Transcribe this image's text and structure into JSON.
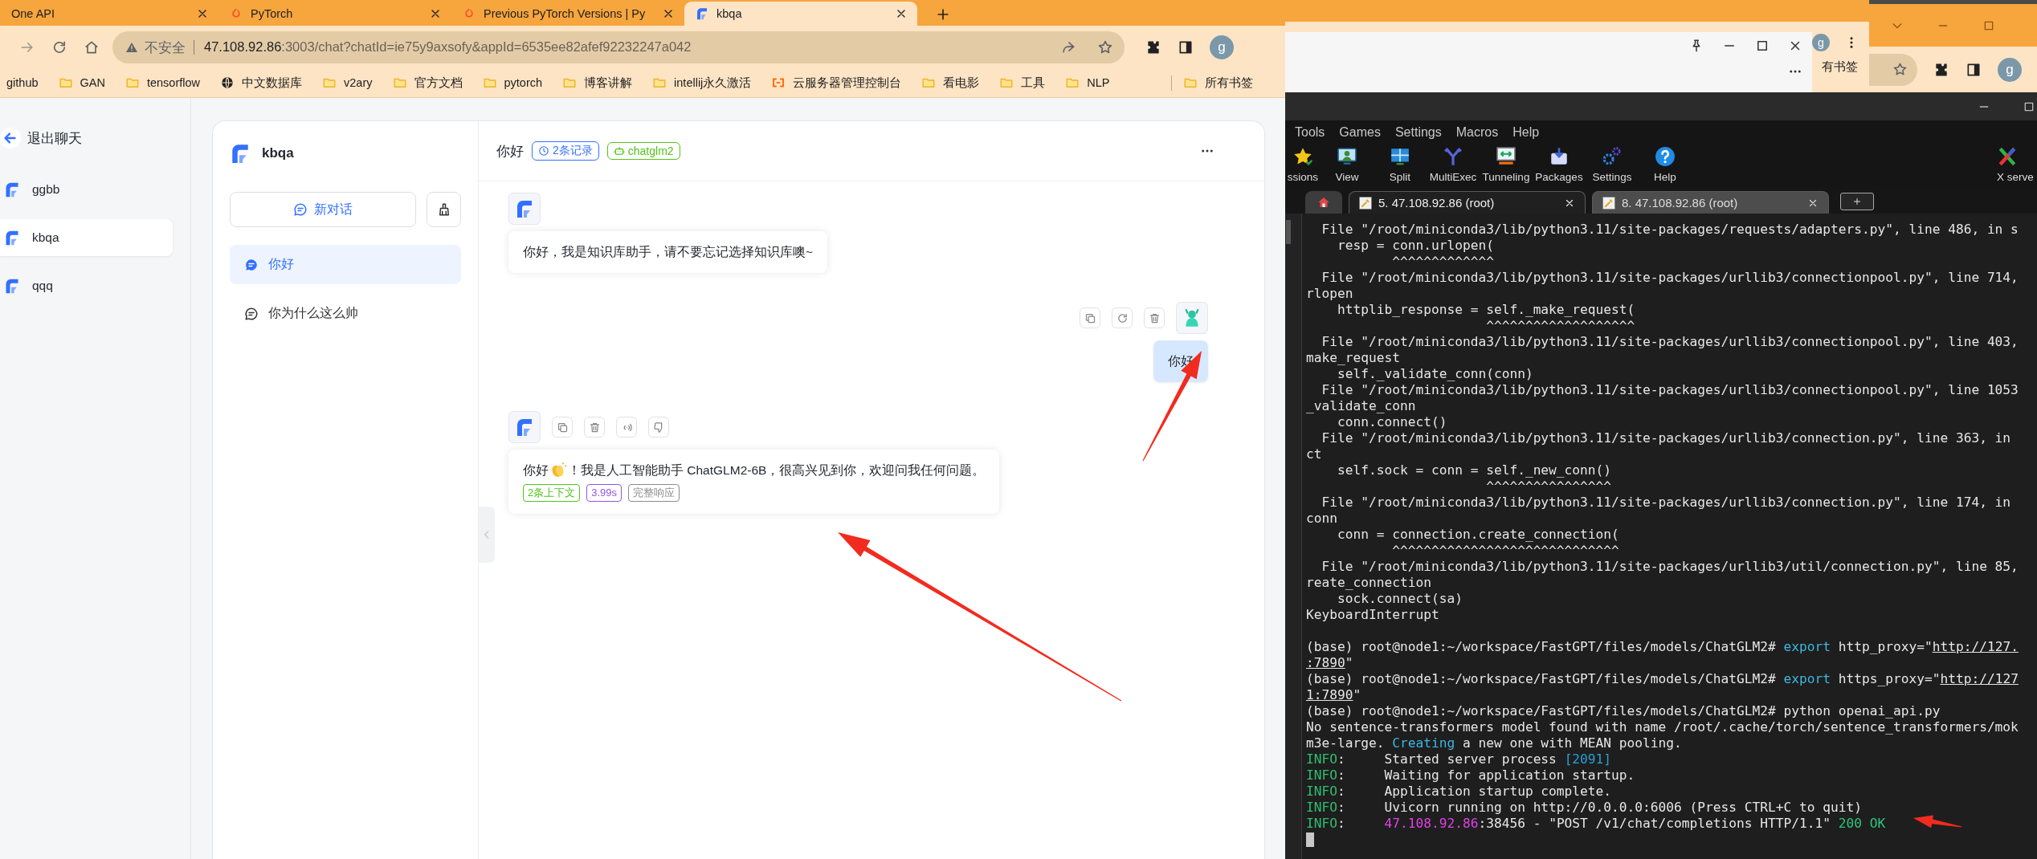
{
  "browser": {
    "tabs": [
      {
        "title": "One API",
        "selected": false
      },
      {
        "title": "PyTorch",
        "selected": false,
        "kind": "pytorch"
      },
      {
        "title": "Previous PyTorch Versions | Py",
        "selected": false,
        "kind": "pytorch"
      },
      {
        "title": "kbqa",
        "selected": true,
        "kind": "app"
      }
    ],
    "address": {
      "security": "不安全",
      "host": "47.108.92.86",
      "path": ":3003/chat?chatId=ie75y9axsofy&appId=6535ee82afef92232247a042"
    },
    "avatar": "g",
    "bookmarks": [
      {
        "label": "github"
      },
      {
        "label": "GAN",
        "kind": "folder"
      },
      {
        "label": "tensorflow",
        "kind": "folder"
      },
      {
        "label": "中文数据库",
        "kind": "globe"
      },
      {
        "label": "v2ary",
        "kind": "folder"
      },
      {
        "label": "官方文档",
        "kind": "folder"
      },
      {
        "label": "pytorch",
        "kind": "folder"
      },
      {
        "label": "博客讲解",
        "kind": "folder"
      },
      {
        "label": "intellij永久激活",
        "kind": "folder"
      },
      {
        "label": "云服务器管理控制台",
        "kind": "cloud"
      },
      {
        "label": "看电影",
        "kind": "folder"
      },
      {
        "label": "工具",
        "kind": "folder"
      },
      {
        "label": "NLP",
        "kind": "folder"
      }
    ],
    "all_bookmarks": "所有书签"
  },
  "sidebar": {
    "back": "退出聊天",
    "apps": [
      {
        "name": "ggbb",
        "selected": false
      },
      {
        "name": "kbqa",
        "selected": true
      },
      {
        "name": "qqq",
        "selected": false
      }
    ]
  },
  "app": {
    "name": "kbqa",
    "new_chat": "新对话",
    "history": [
      {
        "title": "你好",
        "selected": true
      },
      {
        "title": "你为什么这么帅",
        "selected": false
      }
    ]
  },
  "chat": {
    "title": "你好",
    "tags": [
      {
        "label": "2条记录",
        "kind": "history",
        "color": "#3370ff"
      },
      {
        "label": "chatglm2",
        "kind": "model",
        "color": "#52c41a"
      }
    ],
    "messages": [
      {
        "kind": "bot",
        "welcome": true,
        "parts": [
          {
            "kind": "text",
            "text": "你好，我是知识库助手，请不要忘记选择知识库噢~"
          }
        ]
      },
      {
        "kind": "user",
        "parts": [
          {
            "kind": "text",
            "text": "你好"
          }
        ]
      },
      {
        "kind": "bot",
        "welcome": false,
        "parts": [
          {
            "kind": "text",
            "text": "你好"
          },
          {
            "kind": "emoji"
          },
          {
            "kind": "text",
            "text": "！我是人工智能助手 ChatGLM2-6B，很高兴见到你，欢迎问我任何问题。"
          }
        ],
        "tags": [
          {
            "label": "2条上下文",
            "color": "#52c41a"
          },
          {
            "label": "3.99s",
            "color": "#9254de"
          },
          {
            "label": "完整响应",
            "color": "#8c8c8c"
          }
        ]
      }
    ]
  },
  "browser_behind": {
    "avatar": "g",
    "bookmarks_fragment": "有书签"
  },
  "browser_right": {
    "avatar": "g"
  },
  "terminal_app": {
    "menu": [
      "Tools",
      "Games",
      "Settings",
      "Macros",
      "Help"
    ],
    "toolbar": [
      {
        "label": "ssions",
        "kind": "sessions"
      },
      {
        "label": "View",
        "kind": "view"
      },
      {
        "label": "Split",
        "kind": "split"
      },
      {
        "label": "MultiExec",
        "kind": "multiexec"
      },
      {
        "label": "Tunneling",
        "kind": "tunneling"
      },
      {
        "label": "Packages",
        "kind": "packages"
      },
      {
        "label": "Settings",
        "kind": "settings"
      },
      {
        "label": "Help",
        "kind": "help"
      },
      {
        "label": "X serve",
        "kind": "xserver"
      }
    ],
    "tabs": [
      {
        "label": "5. 47.108.92.86 (root)",
        "selected": true
      },
      {
        "label": "8. 47.108.92.86 (root)",
        "selected": false
      }
    ],
    "lines": [
      {
        "segments": [
          {
            "text": "  File \"/root/miniconda3/lib/python3.11/site-packages/requests/adapters.py\", line 486, in s"
          }
        ]
      },
      {
        "segments": [
          {
            "text": "    resp = conn.urlopen("
          }
        ]
      },
      {
        "segments": [
          {
            "text": "           ^^^^^^^^^^^^^"
          }
        ]
      },
      {
        "segments": [
          {
            "text": "  File \"/root/miniconda3/lib/python3.11/site-packages/urllib3/connectionpool.py\", line 714,"
          }
        ]
      },
      {
        "segments": [
          {
            "text": "rlopen"
          }
        ]
      },
      {
        "segments": [
          {
            "text": "    httplib_response = self._make_request("
          }
        ]
      },
      {
        "segments": [
          {
            "text": "                       ^^^^^^^^^^^^^^^^^^^"
          }
        ]
      },
      {
        "segments": [
          {
            "text": "  File \"/root/miniconda3/lib/python3.11/site-packages/urllib3/connectionpool.py\", line 403,"
          }
        ]
      },
      {
        "segments": [
          {
            "text": "make_request"
          }
        ]
      },
      {
        "segments": [
          {
            "text": "    self._validate_conn(conn)"
          }
        ]
      },
      {
        "segments": [
          {
            "text": "  File \"/root/miniconda3/lib/python3.11/site-packages/urllib3/connectionpool.py\", line 1053"
          }
        ]
      },
      {
        "segments": [
          {
            "text": "_validate_conn"
          }
        ]
      },
      {
        "segments": [
          {
            "text": "    conn.connect()"
          }
        ]
      },
      {
        "segments": [
          {
            "text": "  File \"/root/miniconda3/lib/python3.11/site-packages/urllib3/connection.py\", line 363, in"
          }
        ]
      },
      {
        "segments": [
          {
            "text": "ct"
          }
        ]
      },
      {
        "segments": [
          {
            "text": "    self.sock = conn = self._new_conn()"
          }
        ]
      },
      {
        "segments": [
          {
            "text": "                       ^^^^^^^^^^^^^^^^"
          }
        ]
      },
      {
        "segments": [
          {
            "text": "  File \"/root/miniconda3/lib/python3.11/site-packages/urllib3/connection.py\", line 174, in"
          }
        ]
      },
      {
        "segments": [
          {
            "text": "conn"
          }
        ]
      },
      {
        "segments": [
          {
            "text": "    conn = connection.create_connection("
          }
        ]
      },
      {
        "segments": [
          {
            "text": "           ^^^^^^^^^^^^^^^^^^^^^^^^^^^^^"
          }
        ]
      },
      {
        "segments": [
          {
            "text": "  File \"/root/miniconda3/lib/python3.11/site-packages/urllib3/util/connection.py\", line 85,"
          }
        ]
      },
      {
        "segments": [
          {
            "text": "reate_connection"
          }
        ]
      },
      {
        "segments": [
          {
            "text": "    sock.connect(sa)"
          }
        ]
      },
      {
        "segments": [
          {
            "text": "KeyboardInterrupt"
          }
        ]
      },
      {
        "blank_before": true,
        "segments": [
          {
            "text": "(base) root@node1:~/workspace/FastGPT/files/models/ChatGLM2# "
          },
          {
            "text": "export",
            "kind": "keyword"
          },
          {
            "text": " http_proxy=\""
          },
          {
            "text": "http://127.",
            "kind": "link"
          }
        ]
      },
      {
        "segments": [
          {
            "text": ":7890",
            "kind": "link"
          },
          {
            "text": "\""
          }
        ]
      },
      {
        "segments": [
          {
            "text": "(base) root@node1:~/workspace/FastGPT/files/models/ChatGLM2# "
          },
          {
            "text": "export",
            "kind": "keyword"
          },
          {
            "text": " https_proxy=\""
          },
          {
            "text": "http://127",
            "kind": "link"
          }
        ]
      },
      {
        "segments": [
          {
            "text": "1:7890",
            "kind": "link"
          },
          {
            "text": "\""
          }
        ]
      },
      {
        "segments": [
          {
            "text": "(base) root@node1:~/workspace/FastGPT/files/models/ChatGLM2# python openai_api.py"
          }
        ]
      },
      {
        "segments": [
          {
            "text": "No sentence-transformers model found with name /root/.cache/torch/sentence_transformers/mok"
          }
        ]
      },
      {
        "segments": [
          {
            "text": "m3e-large. "
          },
          {
            "text": "Creating",
            "kind": "keyword"
          },
          {
            "text": " a new one with MEAN pooling."
          }
        ]
      },
      {
        "segments": [
          {
            "text": "INFO",
            "kind": "info"
          },
          {
            "text": ":     Started server process "
          },
          {
            "text": "[2091]",
            "kind": "number"
          }
        ]
      },
      {
        "segments": [
          {
            "text": "INFO",
            "kind": "info"
          },
          {
            "text": ":     Waiting for application startup."
          }
        ]
      },
      {
        "segments": [
          {
            "text": "INFO",
            "kind": "info"
          },
          {
            "text": ":     Application startup complete."
          }
        ]
      },
      {
        "segments": [
          {
            "text": "INFO",
            "kind": "info"
          },
          {
            "text": ":     Uvicorn running on http://0.0.0.0:6006 (Press CTRL+C to quit)"
          }
        ]
      },
      {
        "segments": [
          {
            "text": "INFO",
            "kind": "info"
          },
          {
            "text": ":     "
          },
          {
            "text": "47.108.92.86",
            "kind": "host"
          },
          {
            "text": ":38456 - \"POST /v1/chat/completions HTTP/1.1\" "
          },
          {
            "text": "200 OK",
            "kind": "ok"
          }
        ]
      }
    ],
    "cursor": true
  }
}
